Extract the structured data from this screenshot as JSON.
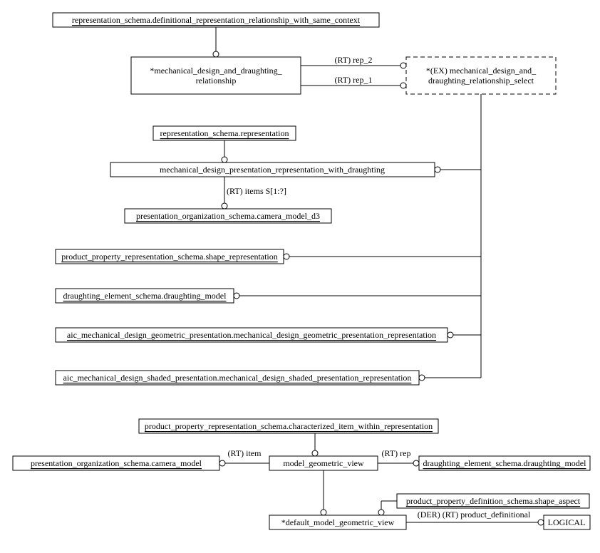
{
  "nodes": {
    "n1": "representation_schema.definitional_representation_relationship_with_same_context",
    "n2a": "*mechanical_design_and_draughting_",
    "n2b": "relationship",
    "n3a": "*(EX) mechanical_design_and_",
    "n3b": "draughting_relationship_select",
    "n4": "representation_schema.representation",
    "n5": "mechanical_design_presentation_representation_with_draughting",
    "n6": "presentation_organization_schema.camera_model_d3",
    "n7": "product_property_representation_schema.shape_representation",
    "n8": "draughting_element_schema.draughting_model",
    "n9": "aic_mechanical_design_geometric_presentation.mechanical_design_geometric_presentation_representation",
    "n10": "aic_mechanical_design_shaded_presentation.mechanical_design_shaded_presentation_representation",
    "n11": "product_property_representation_schema.characterized_item_within_representation",
    "n12": "presentation_organization_schema.camera_model",
    "n13": "model_geometric_view",
    "n14": "draughting_element_schema.draughting_model",
    "n15": "*default_model_geometric_view",
    "n16": "product_property_definition_schema.shape_aspect",
    "n17": "LOGICAL"
  },
  "edges": {
    "e1": "(RT) rep_2",
    "e2": "(RT) rep_1",
    "e3": "(RT) items S[1:?]",
    "e4": "(RT) item",
    "e5": "(RT) rep",
    "e6": "(DER) (RT) product_definitional"
  }
}
